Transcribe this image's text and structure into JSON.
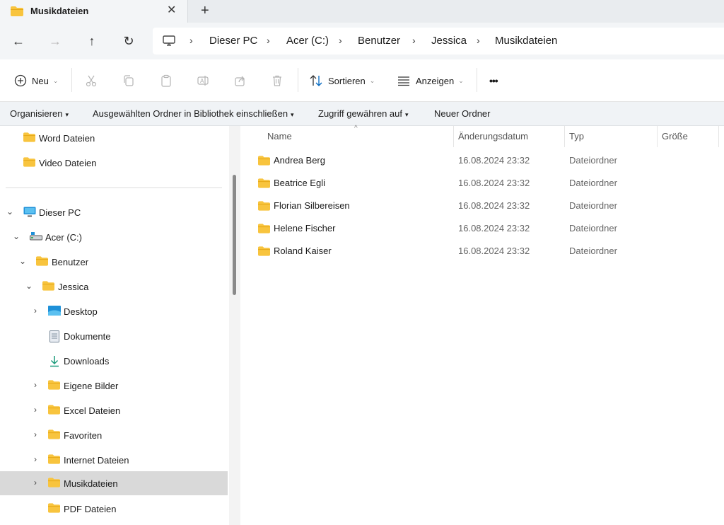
{
  "tab": {
    "title": "Musikdateien",
    "close": "✕",
    "new_tab": "+"
  },
  "nav_buttons": {
    "back": "←",
    "forward": "→",
    "up": "↑",
    "refresh": "↻"
  },
  "breadcrumb": {
    "separator": "›",
    "items": [
      "Dieser PC",
      "Acer (C:)",
      "Benutzer",
      "Jessica",
      "Musikdateien"
    ]
  },
  "toolbar": {
    "new_label": "Neu",
    "sort_label": "Sortieren",
    "view_label": "Anzeigen",
    "more": "•••",
    "caret": "⌄"
  },
  "library_bar": {
    "organize": "Organisieren",
    "include_library": "Ausgewählten Ordner in Bibliothek einschließen",
    "grant_access": "Zugriff gewähren auf",
    "new_folder": "Neuer Ordner",
    "tri": "▾"
  },
  "sidebar": {
    "items": [
      {
        "label": "Word Dateien",
        "icon": "folder-icon"
      },
      {
        "label": "Video Dateien",
        "icon": "folder-icon"
      },
      {
        "label": "Dieser PC",
        "icon": "monitor-icon",
        "chevron": "⌄"
      },
      {
        "label": "Acer (C:)",
        "icon": "drive-icon",
        "chevron": "⌄"
      },
      {
        "label": "Benutzer",
        "icon": "folder-icon",
        "chevron": "⌄"
      },
      {
        "label": "Jessica",
        "icon": "folder-icon",
        "chevron": "⌄"
      },
      {
        "label": "Desktop",
        "icon": "desktop-icon",
        "chevron": "›"
      },
      {
        "label": "Dokumente",
        "icon": "document-icon"
      },
      {
        "label": "Downloads",
        "icon": "download-icon"
      },
      {
        "label": "Eigene Bilder",
        "icon": "folder-icon",
        "chevron": "›"
      },
      {
        "label": "Excel Dateien",
        "icon": "folder-icon",
        "chevron": "›"
      },
      {
        "label": "Favoriten",
        "icon": "folder-icon",
        "chevron": "›"
      },
      {
        "label": "Internet Dateien",
        "icon": "folder-icon",
        "chevron": "›"
      },
      {
        "label": "Musikdateien",
        "icon": "folder-icon",
        "chevron": "›",
        "selected": true
      },
      {
        "label": "PDF Dateien",
        "icon": "folder-icon"
      }
    ]
  },
  "file_list": {
    "columns": [
      "Name",
      "Änderungsdatum",
      "Typ",
      "Größe"
    ],
    "sort_indicator": "^",
    "rows": [
      {
        "name": "Andrea Berg",
        "date": "16.08.2024 23:32",
        "type": "Dateiordner"
      },
      {
        "name": "Beatrice Egli",
        "date": "16.08.2024 23:32",
        "type": "Dateiordner"
      },
      {
        "name": "Florian Silbereisen",
        "date": "16.08.2024 23:32",
        "type": "Dateiordner"
      },
      {
        "name": "Helene Fischer",
        "date": "16.08.2024 23:32",
        "type": "Dateiordner"
      },
      {
        "name": "Roland Kaiser",
        "date": "16.08.2024 23:32",
        "type": "Dateiordner"
      }
    ]
  },
  "colors": {
    "folder": "#f8c43e",
    "folder_dark": "#e6a817",
    "selected": "#d9d9d9",
    "accent": "#0067c0"
  }
}
